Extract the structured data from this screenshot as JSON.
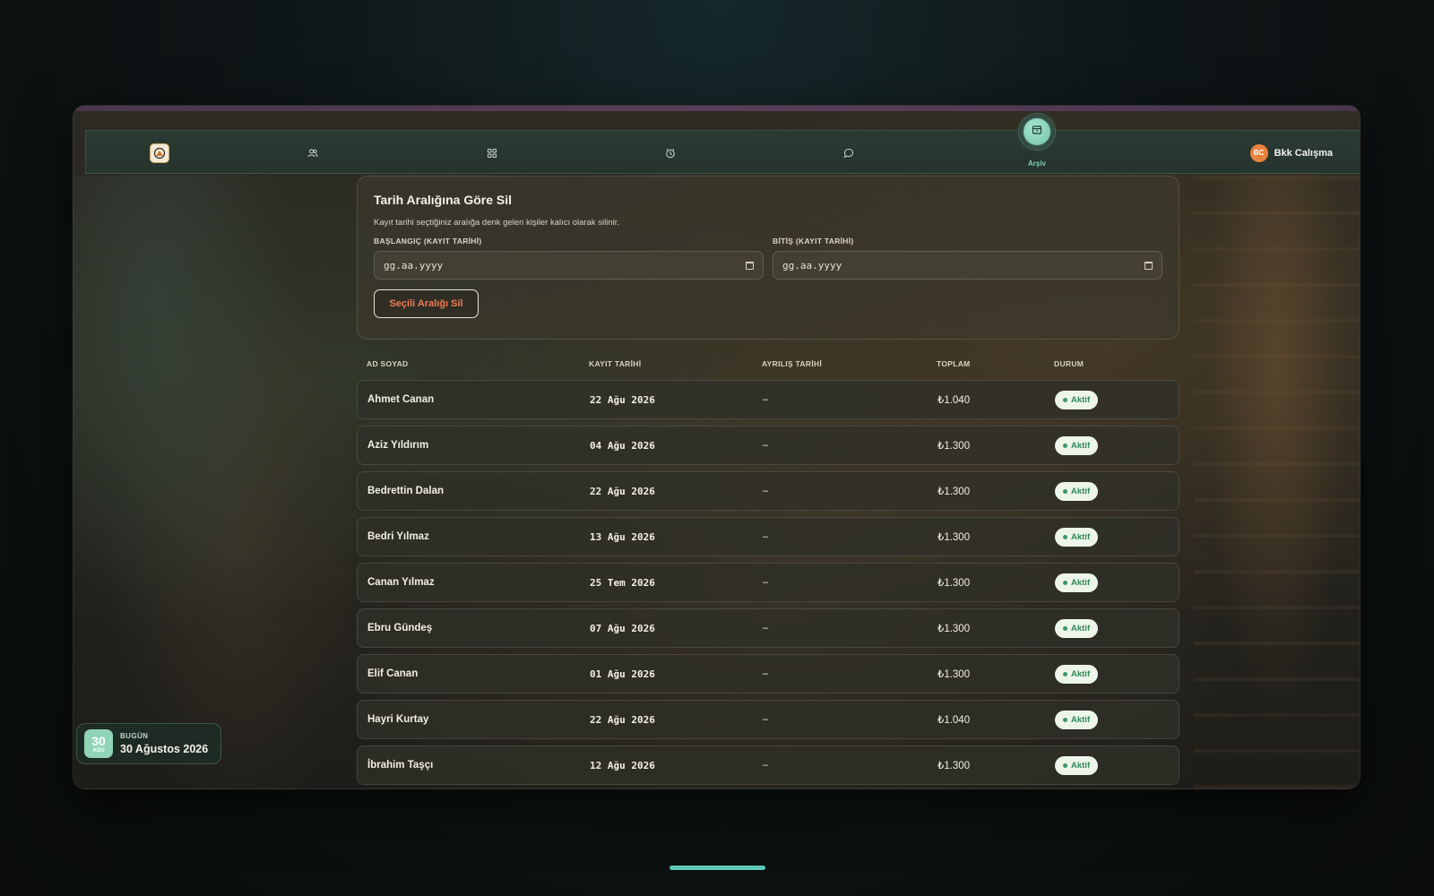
{
  "nav": {
    "items": [
      {
        "icon": "logo-icon"
      },
      {
        "icon": "users-icon"
      },
      {
        "icon": "grid-icon"
      },
      {
        "icon": "clock-icon"
      },
      {
        "icon": "chat-icon"
      }
    ],
    "active": {
      "icon": "archive-icon",
      "label": "Arşiv"
    },
    "user": {
      "initials": "BC",
      "name": "Bkk Calışma"
    },
    "accent": "#7fd3b5"
  },
  "delete_card": {
    "title": "Tarih Aralığına Göre Sil",
    "description": "Kayıt tarihi seçtiğiniz aralığa denk gelen kişiler kalıcı olarak silinir.",
    "start_label": "BAŞLANGIÇ (KAYIT TARİHİ)",
    "start_placeholder": "gg.aa.yyyy",
    "end_label": "BİTİŞ (KAYIT TARİHİ)",
    "end_placeholder": "gg.aa.yyyy",
    "button_label": "Seçili Aralığı Sil",
    "button_color": "#f07a55"
  },
  "table": {
    "headers": [
      "AD SOYAD",
      "KAYIT TARİHİ",
      "AYRILIŞ TARİHİ",
      "TOPLAM",
      "DURUM"
    ],
    "rows": [
      {
        "name": "Ahmet Canan",
        "date": "22 Ağu 2026",
        "leave": "–",
        "total": "₺1.040",
        "status": "Aktif"
      },
      {
        "name": "Aziz Yıldırım",
        "date": "04 Ağu 2026",
        "leave": "–",
        "total": "₺1.300",
        "status": "Aktif"
      },
      {
        "name": "Bedrettin Dalan",
        "date": "22 Ağu 2026",
        "leave": "–",
        "total": "₺1.300",
        "status": "Aktif"
      },
      {
        "name": "Bedri Yılmaz",
        "date": "13 Ağu 2026",
        "leave": "–",
        "total": "₺1.300",
        "status": "Aktif"
      },
      {
        "name": "Canan Yılmaz",
        "date": "25 Tem 2026",
        "leave": "–",
        "total": "₺1.300",
        "status": "Aktif"
      },
      {
        "name": "Ebru Gündeş",
        "date": "07 Ağu 2026",
        "leave": "–",
        "total": "₺1.300",
        "status": "Aktif"
      },
      {
        "name": "Elif Canan",
        "date": "01 Ağu 2026",
        "leave": "–",
        "total": "₺1.300",
        "status": "Aktif"
      },
      {
        "name": "Hayri Kurtay",
        "date": "22 Ağu 2026",
        "leave": "–",
        "total": "₺1.040",
        "status": "Aktif"
      },
      {
        "name": "İbrahim Taşçı",
        "date": "12 Ağu 2026",
        "leave": "–",
        "total": "₺1.300",
        "status": "Aktif"
      }
    ],
    "status_color": "#2f8a55"
  },
  "today": {
    "day": "30",
    "month_short": "AĞU",
    "label": "BUGÜN",
    "date": "30 Ağustos 2026"
  }
}
